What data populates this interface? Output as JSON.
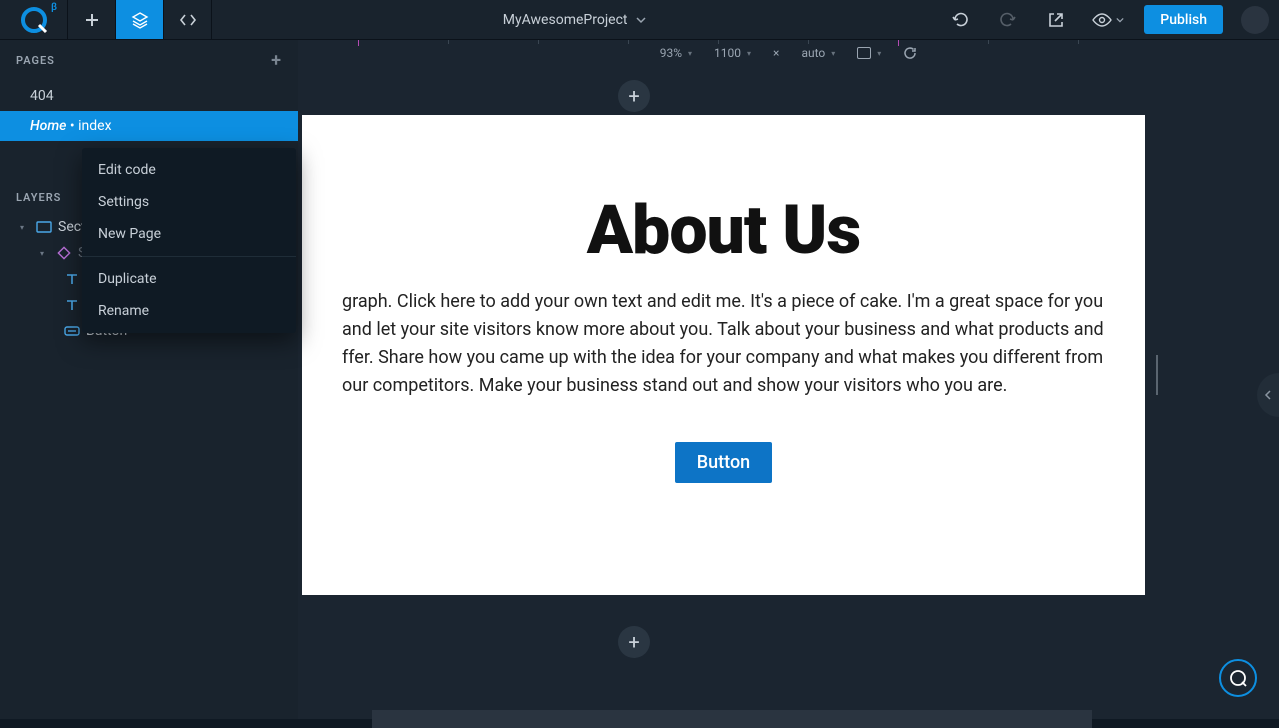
{
  "topbar": {
    "project_name": "MyAwesomeProject",
    "beta_tag": "β",
    "publish_label": "Publish"
  },
  "canvas_toolbar": {
    "zoom": "93%",
    "width": "1100",
    "times": "×",
    "height": "auto"
  },
  "pages": {
    "title": "PAGES",
    "items": [
      {
        "label": "404"
      },
      {
        "label_prefix": "Home",
        "label_suffix": " • index"
      }
    ]
  },
  "layers": {
    "title": "LAYERS",
    "items": [
      {
        "label": "Sect"
      },
      {
        "label": "S"
      },
      {
        "label": "Text"
      },
      {
        "label": "Text"
      },
      {
        "label": "Button"
      }
    ]
  },
  "context_menu": {
    "items": [
      "Edit code",
      "Settings",
      "New Page",
      "Duplicate",
      "Rename"
    ]
  },
  "preview": {
    "heading": "About Us",
    "paragraph": "graph. Click here to add your own text and edit me. It's a piece of cake. I'm a great space for you and let your site visitors know more about you. Talk about your business and what products and ffer. Share how you came up with the idea for your company and what makes you different from our competitors. Make your business stand out and show your visitors who you are.",
    "button_label": "Button"
  },
  "colors": {
    "accent": "#0d8fe1",
    "bg_dark": "#19232d"
  }
}
